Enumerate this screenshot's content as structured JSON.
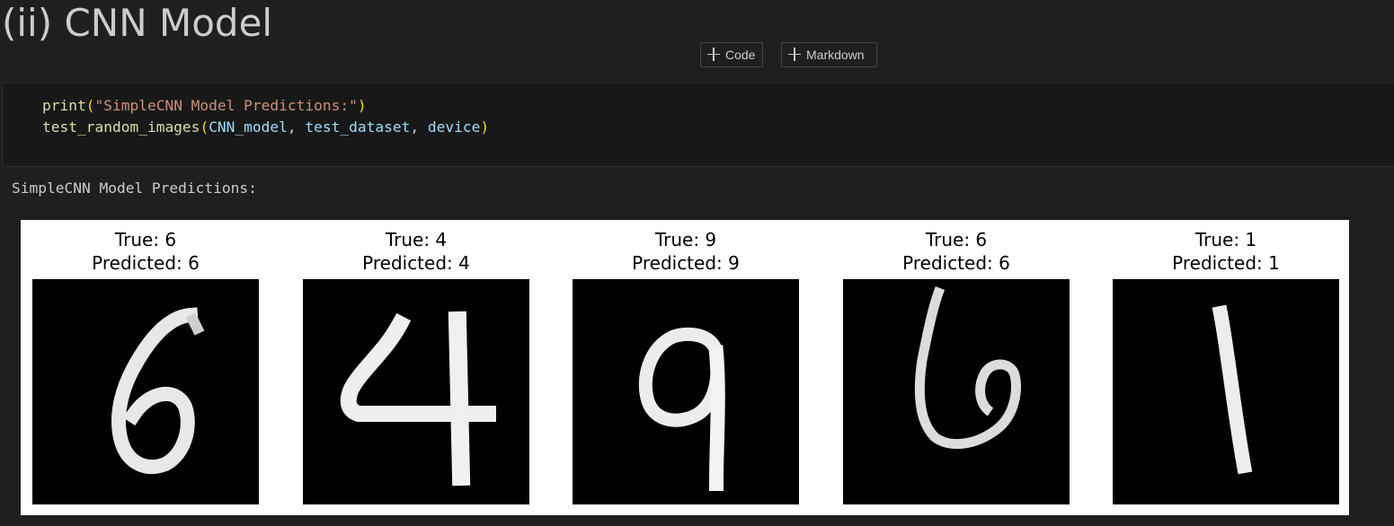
{
  "heading": "(ii) CNN Model",
  "toolbar": {
    "add_code_label": "Code",
    "add_markdown_label": "Markdown"
  },
  "code_cell": {
    "line1": {
      "fn": "print",
      "open": "(",
      "arg": "\"SimpleCNN Model Predictions:\"",
      "close": ")"
    },
    "line2": {
      "fn": "test_random_images",
      "open": "(",
      "arg1": "CNN_model",
      "sep1": ", ",
      "arg2": "test_dataset",
      "sep2": ", ",
      "arg3": "device",
      "close": ")"
    }
  },
  "output": {
    "text": "SimpleCNN Model Predictions:",
    "panels": [
      {
        "true_label": "True: 6",
        "predicted_label": "Predicted: 6",
        "digit": "6"
      },
      {
        "true_label": "True: 4",
        "predicted_label": "Predicted: 4",
        "digit": "4"
      },
      {
        "true_label": "True: 9",
        "predicted_label": "Predicted: 9",
        "digit": "9"
      },
      {
        "true_label": "True: 6",
        "predicted_label": "Predicted: 6",
        "digit": "6"
      },
      {
        "true_label": "True: 1",
        "predicted_label": "Predicted: 1",
        "digit": "1"
      }
    ]
  },
  "colors": {
    "background": "#1f1f1f",
    "code_background": "#181818",
    "function": "#dcdcaa",
    "string": "#ce9178",
    "variable": "#9cdcfe",
    "bracket": "#ffd700"
  }
}
